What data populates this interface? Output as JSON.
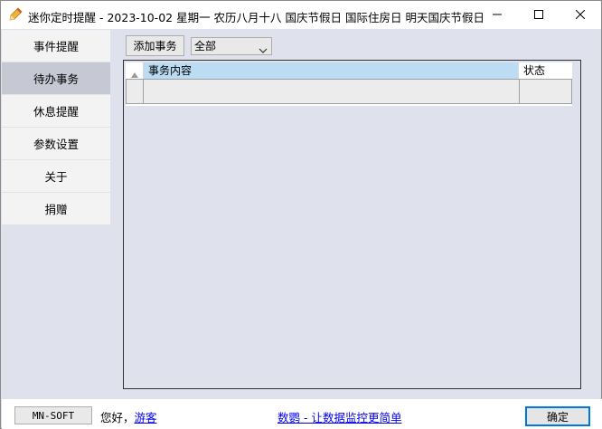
{
  "window": {
    "title": "迷你定时提醒 - 2023-10-02 星期一 农历八月十八 国庆节假日 国际住房日 明天国庆节假日"
  },
  "sidebar": {
    "items": [
      {
        "label": "事件提醒",
        "active": false
      },
      {
        "label": "待办事务",
        "active": true
      },
      {
        "label": "休息提醒",
        "active": false
      },
      {
        "label": "参数设置",
        "active": false
      },
      {
        "label": "关于",
        "active": false
      },
      {
        "label": "捐赠",
        "active": false
      }
    ]
  },
  "toolbar": {
    "add_label": "添加事务",
    "filter_value": "全部"
  },
  "grid": {
    "columns": [
      "事务内容",
      "状态"
    ],
    "rows": [
      {
        "content": "",
        "status": ""
      }
    ]
  },
  "statusbar": {
    "brand": "MN-SOFT",
    "greeting": "您好，",
    "guest": "游客",
    "promo": "数鹦 - 让数据监控更简单",
    "ok_label": "确定"
  },
  "colors": {
    "background": "#dfe1ec",
    "active_item": "#c6c8d3",
    "header_highlight": "#bcdcf4",
    "link": "#0000ee",
    "focus_border": "#0078d7"
  },
  "icons": {
    "app": "notepad-pen-icon",
    "minimize": "minimize-icon",
    "maximize": "maximize-icon",
    "close": "close-icon",
    "dropdown": "chevron-down-icon",
    "sort": "sort-up-icon"
  }
}
